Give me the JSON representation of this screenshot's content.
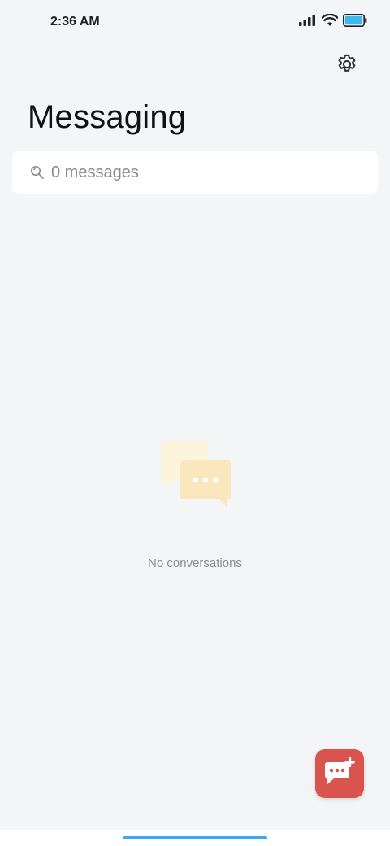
{
  "status_bar": {
    "time": "2:36 AM",
    "icons": [
      "signal-icon",
      "wifi-icon",
      "battery-icon"
    ],
    "battery_color": "#3fb8f0"
  },
  "header": {
    "title": "Messaging",
    "settings_icon": "gear-icon"
  },
  "search": {
    "placeholder": "0 messages",
    "icon": "search-icon"
  },
  "empty_state": {
    "illustration": "chat-bubbles-icon",
    "message": "No conversations"
  },
  "fab": {
    "icon": "new-message-icon",
    "color": "#d9534f"
  },
  "colors": {
    "background": "#f4f5f7",
    "home_indicator": "#3fa9f5"
  }
}
